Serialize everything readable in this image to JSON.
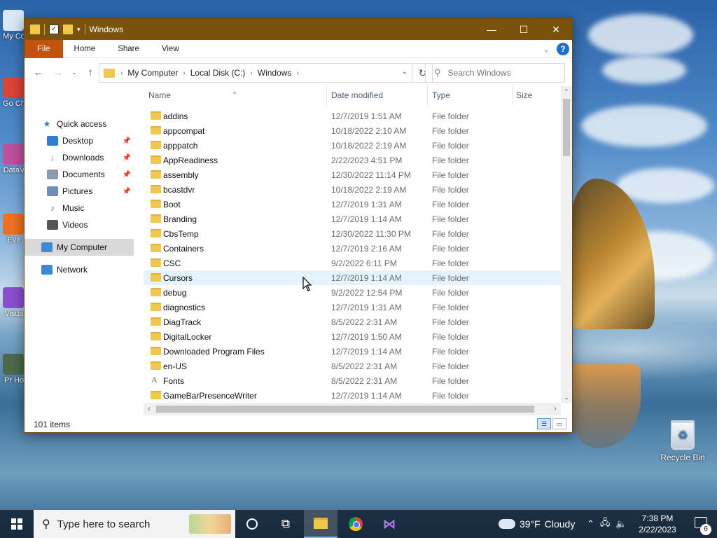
{
  "desktop": {
    "icons": [
      {
        "label": "My Co",
        "color": "#d8e8f8"
      },
      {
        "label": "Go Ch",
        "color": "#db4437"
      },
      {
        "label": "DataV",
        "color": "#c04fa0"
      },
      {
        "label": "Eve",
        "color": "#f07020"
      },
      {
        "label": "Visua",
        "color": "#8a4fd0"
      },
      {
        "label": "Pr Ho",
        "color": "#4a6a4a"
      }
    ],
    "recycle_bin": "Recycle Bin"
  },
  "window": {
    "title": "Windows",
    "ribbon_tabs": [
      "File",
      "Home",
      "Share",
      "View"
    ],
    "help": "?",
    "address": {
      "crumbs": [
        "My Computer",
        "Local Disk (C:)",
        "Windows"
      ]
    },
    "search": {
      "placeholder": "Search Windows"
    },
    "nav_pane": [
      {
        "label": "Quick access",
        "icon": "star-icon",
        "glyph": "★",
        "color": "#2a7fd4",
        "pinned": false,
        "indent": false
      },
      {
        "label": "Desktop",
        "icon": "desktop-icon",
        "glyph": "",
        "color": "#2a7fd4",
        "pinned": true,
        "indent": true
      },
      {
        "label": "Downloads",
        "icon": "download-arrow-icon",
        "glyph": "↓",
        "color": "#2a7fd4",
        "pinned": true,
        "indent": true
      },
      {
        "label": "Documents",
        "icon": "document-icon",
        "glyph": "",
        "color": "#8a9bb0",
        "pinned": true,
        "indent": true
      },
      {
        "label": "Pictures",
        "icon": "pictures-icon",
        "glyph": "",
        "color": "#6b8fb8",
        "pinned": true,
        "indent": true
      },
      {
        "label": "Music",
        "icon": "music-note-icon",
        "glyph": "♪",
        "color": "#2a7fd4",
        "pinned": false,
        "indent": true
      },
      {
        "label": "Videos",
        "icon": "film-icon",
        "glyph": "",
        "color": "#555",
        "pinned": false,
        "indent": true
      },
      {
        "label": "My Computer",
        "icon": "computer-icon",
        "glyph": "",
        "color": "#3a8ad8",
        "pinned": false,
        "indent": false,
        "selected": true
      },
      {
        "label": "Network",
        "icon": "network-icon",
        "glyph": "",
        "color": "#3a8ad8",
        "pinned": false,
        "indent": false
      }
    ],
    "columns": {
      "name": "Name",
      "date": "Date modified",
      "type": "Type",
      "size": "Size"
    },
    "files": [
      {
        "name": "addins",
        "date": "12/7/2019 1:51 AM",
        "type": "File folder"
      },
      {
        "name": "appcompat",
        "date": "10/18/2022 2:10 AM",
        "type": "File folder"
      },
      {
        "name": "apppatch",
        "date": "10/18/2022 2:19 AM",
        "type": "File folder"
      },
      {
        "name": "AppReadiness",
        "date": "2/22/2023 4:51 PM",
        "type": "File folder"
      },
      {
        "name": "assembly",
        "date": "12/30/2022 11:14 PM",
        "type": "File folder"
      },
      {
        "name": "bcastdvr",
        "date": "10/18/2022 2:19 AM",
        "type": "File folder"
      },
      {
        "name": "Boot",
        "date": "12/7/2019 1:31 AM",
        "type": "File folder"
      },
      {
        "name": "Branding",
        "date": "12/7/2019 1:14 AM",
        "type": "File folder"
      },
      {
        "name": "CbsTemp",
        "date": "12/30/2022 11:30 PM",
        "type": "File folder"
      },
      {
        "name": "Containers",
        "date": "12/7/2019 2:16 AM",
        "type": "File folder"
      },
      {
        "name": "CSC",
        "date": "9/2/2022 6:11 PM",
        "type": "File folder"
      },
      {
        "name": "Cursors",
        "date": "12/7/2019 1:14 AM",
        "type": "File folder",
        "hover": true
      },
      {
        "name": "debug",
        "date": "9/2/2022 12:54 PM",
        "type": "File folder"
      },
      {
        "name": "diagnostics",
        "date": "12/7/2019 1:31 AM",
        "type": "File folder"
      },
      {
        "name": "DiagTrack",
        "date": "8/5/2022 2:31 AM",
        "type": "File folder"
      },
      {
        "name": "DigitalLocker",
        "date": "12/7/2019 1:50 AM",
        "type": "File folder"
      },
      {
        "name": "Downloaded Program Files",
        "date": "12/7/2019 1:14 AM",
        "type": "File folder"
      },
      {
        "name": "en-US",
        "date": "8/5/2022 2:31 AM",
        "type": "File folder"
      },
      {
        "name": "Fonts",
        "date": "8/5/2022 2:31 AM",
        "type": "File folder",
        "icon": "fonts"
      },
      {
        "name": "GameBarPresenceWriter",
        "date": "12/7/2019 1:14 AM",
        "type": "File folder"
      }
    ],
    "status": "101 items"
  },
  "taskbar": {
    "search_placeholder": "Type here to search",
    "weather_temp": "39°F",
    "weather_desc": "Cloudy",
    "time": "7:38 PM",
    "date": "2/22/2023",
    "notification_count": "6"
  }
}
